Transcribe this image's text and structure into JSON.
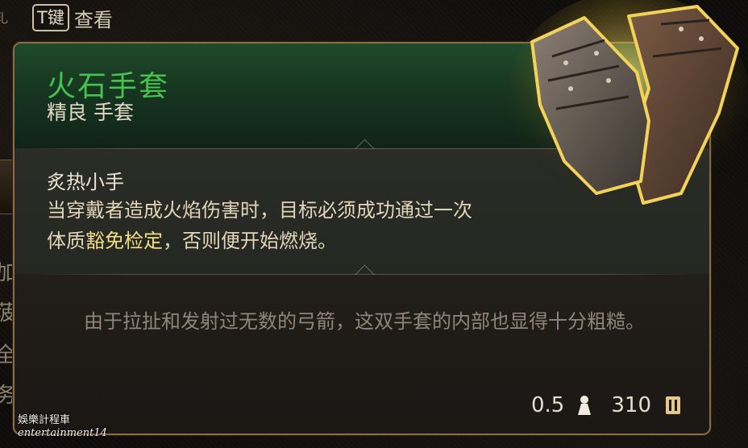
{
  "hint": {
    "key": "T键",
    "label": "查看"
  },
  "left_edge": [
    "玌",
    "加",
    "菠",
    "全",
    "务"
  ],
  "item": {
    "name": "火石手套",
    "subtitle": "精良 手套",
    "ability_name": "炙热小手",
    "ability_desc_1": "当穿戴者造成火焰伤害时，目标必须成功通过一次",
    "ability_desc_2a": "体质",
    "ability_desc_2b": "豁免检定",
    "ability_desc_2c": "，否则便开始燃烧。",
    "flavor": "由于拉扯和发射过无数的弓箭，这双手套的内部也显得十分粗糙。"
  },
  "footer": {
    "weight": "0.5",
    "value": "310"
  },
  "icons": {
    "weight": "weight-icon",
    "gold": "gold-coin-icon",
    "item": "gauntlets-icon"
  },
  "colors": {
    "item_name": "#47c24f",
    "keyword_highlight": "#f3df83",
    "frame_border": "#8a6c45",
    "header_green": "#1f4a2a"
  },
  "watermark": {
    "line1": "娛樂計程車",
    "line2": "entertainment14"
  }
}
